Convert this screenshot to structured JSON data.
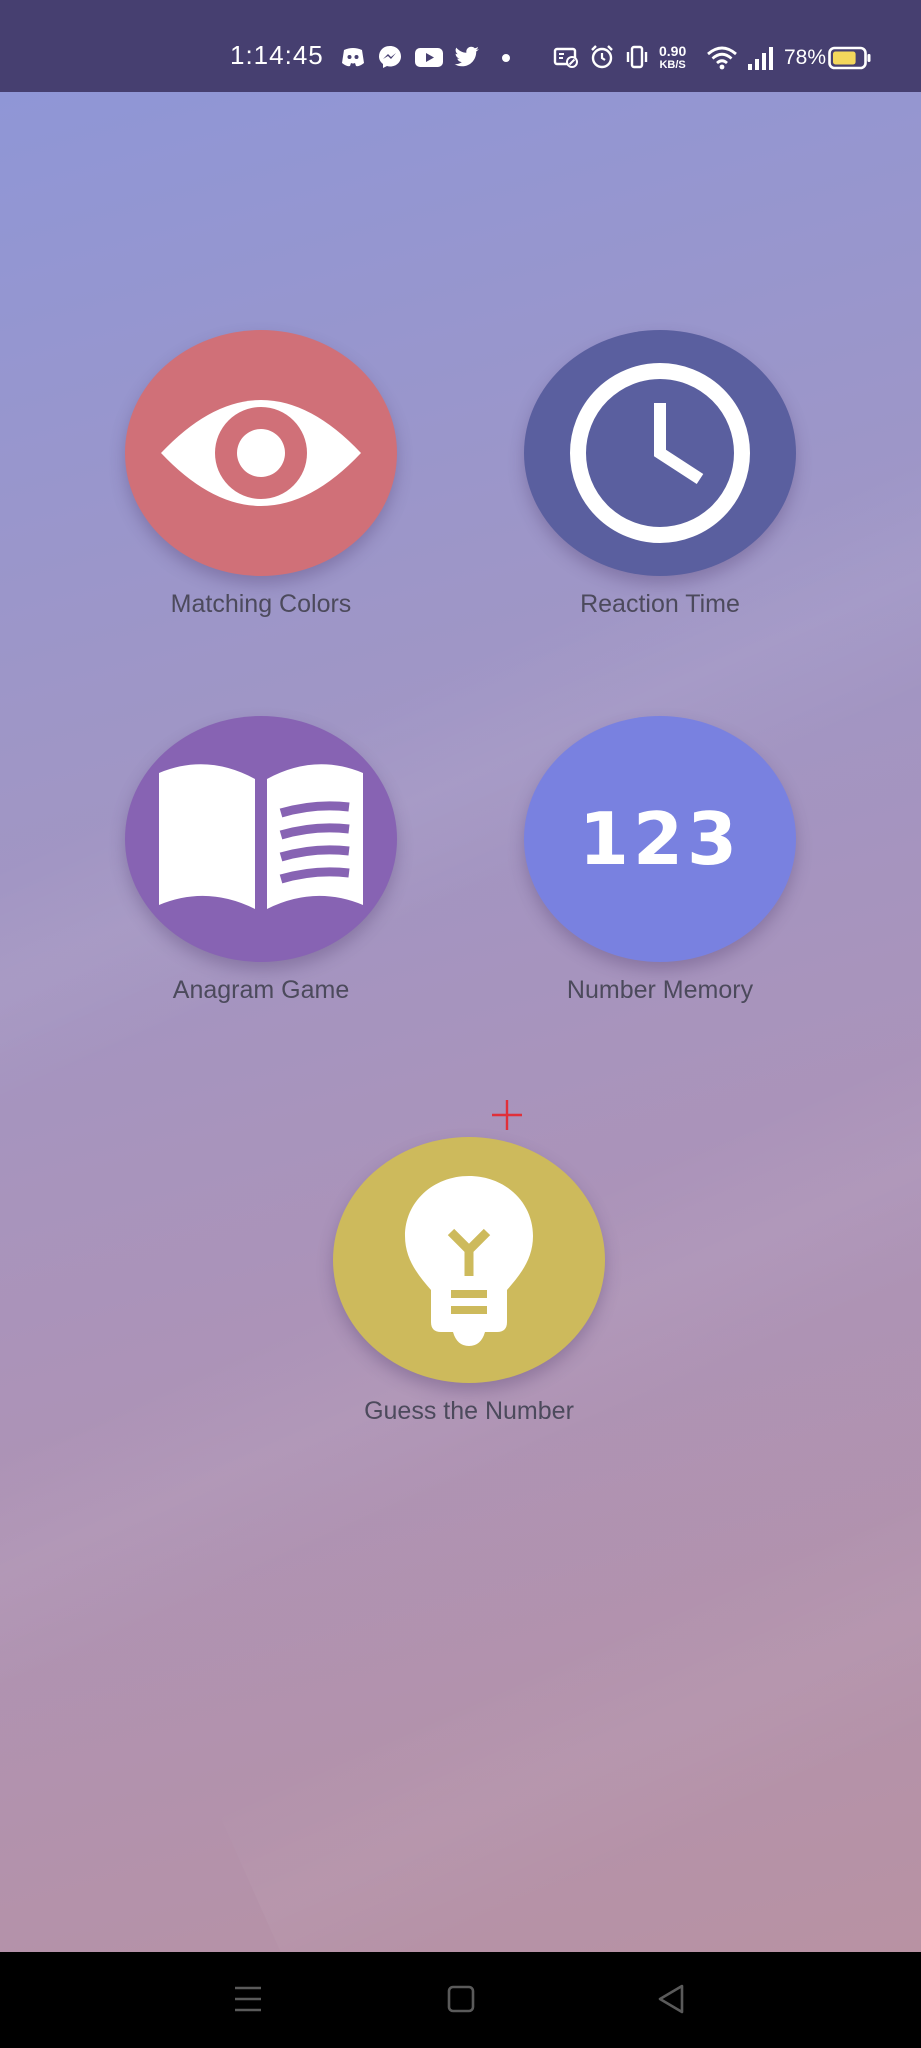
{
  "status_bar": {
    "time": "1:14:45",
    "notification_icons": [
      "discord-icon",
      "messenger-icon",
      "youtube-icon",
      "twitter-icon",
      "dot-icon"
    ],
    "net_speed_value": "0.90",
    "net_speed_unit": "KB/S",
    "battery_percent": "78%",
    "battery_level": 0.78
  },
  "games": [
    {
      "label": "Matching Colors",
      "icon": "eye-icon",
      "color": "#d07078"
    },
    {
      "label": "Reaction Time",
      "icon": "clock-icon",
      "color": "#5a5f9f"
    },
    {
      "label": "Anagram Game",
      "icon": "book-icon",
      "color": "#8763b3"
    },
    {
      "label": "Number Memory",
      "icon": "numbers-icon",
      "icon_text": "123",
      "color": "#7981e0"
    },
    {
      "label": "Guess the Number",
      "icon": "lightbulb-icon",
      "color": "#cdba5c"
    }
  ],
  "nav_bar": {
    "buttons": [
      "menu-icon",
      "home-icon",
      "back-icon"
    ]
  },
  "colors": {
    "status_bar": "#463f70",
    "gradient_top": "#8f96d6",
    "gradient_bottom": "#b892a3",
    "label_text": "#4c4a5c"
  }
}
